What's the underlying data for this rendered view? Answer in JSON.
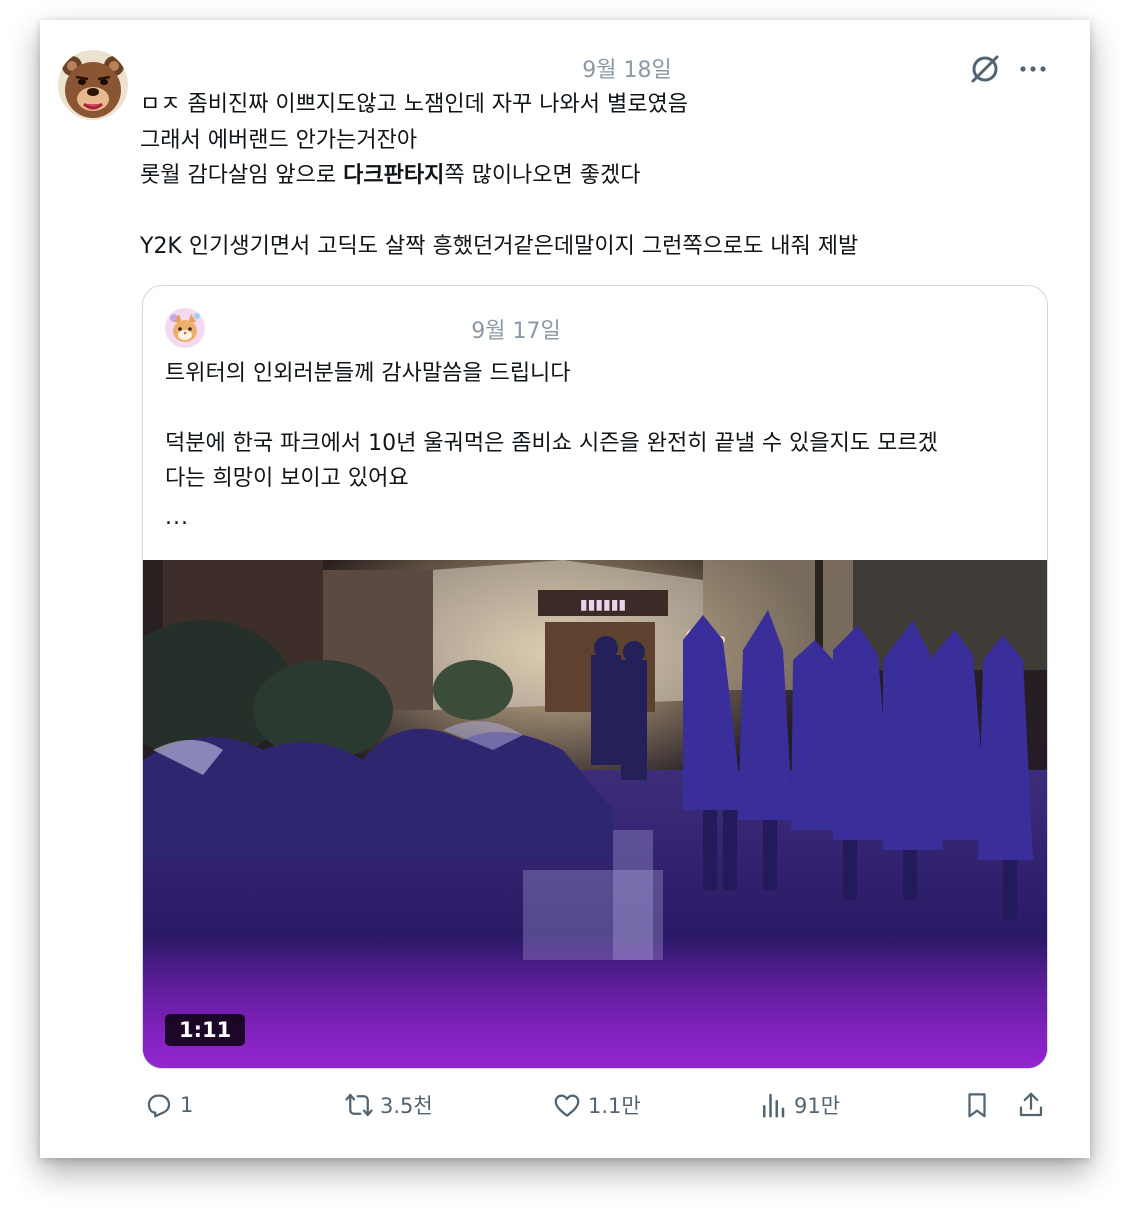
{
  "tweet": {
    "date": "9월 18일",
    "lines": [
      "ㅁㅈ 좀비진짜 이쁘지도않고 노잼인데 자꾸 나와서 별로였음",
      "그래서 에버랜드 안가는거잔아"
    ],
    "line3_before": "롯월 감다살임 앞으로 ",
    "line3_bold": "다크판타지",
    "line3_after": "쪽 많이나오면 좋겠다",
    "line4": "Y2K 인기생기면서 고딕도 살짝 흥했던거같은데말이지 그런쪽으로도 내줘 제발"
  },
  "quote": {
    "date": "9월 17일",
    "line1": "트위터의 인외러분들께 감사말씀을 드립니다",
    "line2": "덕분에 한국 파크에서 10년 울궈먹은 좀비쇼 시즌을 완전히 끝낼 수 있을지도 모르겠",
    "line3": "다는 희망이 보이고 있어요",
    "ellipsis": "...",
    "video_duration": "1:11"
  },
  "actions": {
    "replies": "1",
    "retweets": "3.5천",
    "likes": "1.1만",
    "views": "91만"
  },
  "icons": {
    "hide": "eye-off-icon",
    "more": "more-icon",
    "reply": "reply-icon",
    "retweet": "retweet-icon",
    "like": "heart-icon",
    "views": "views-icon",
    "bookmark": "bookmark-icon",
    "share": "share-icon"
  },
  "colors": {
    "text": "#0f1419",
    "muted": "#8b98a5",
    "action": "#536471",
    "border": "#cfd9de",
    "video_tint": "#6a1fb8"
  }
}
